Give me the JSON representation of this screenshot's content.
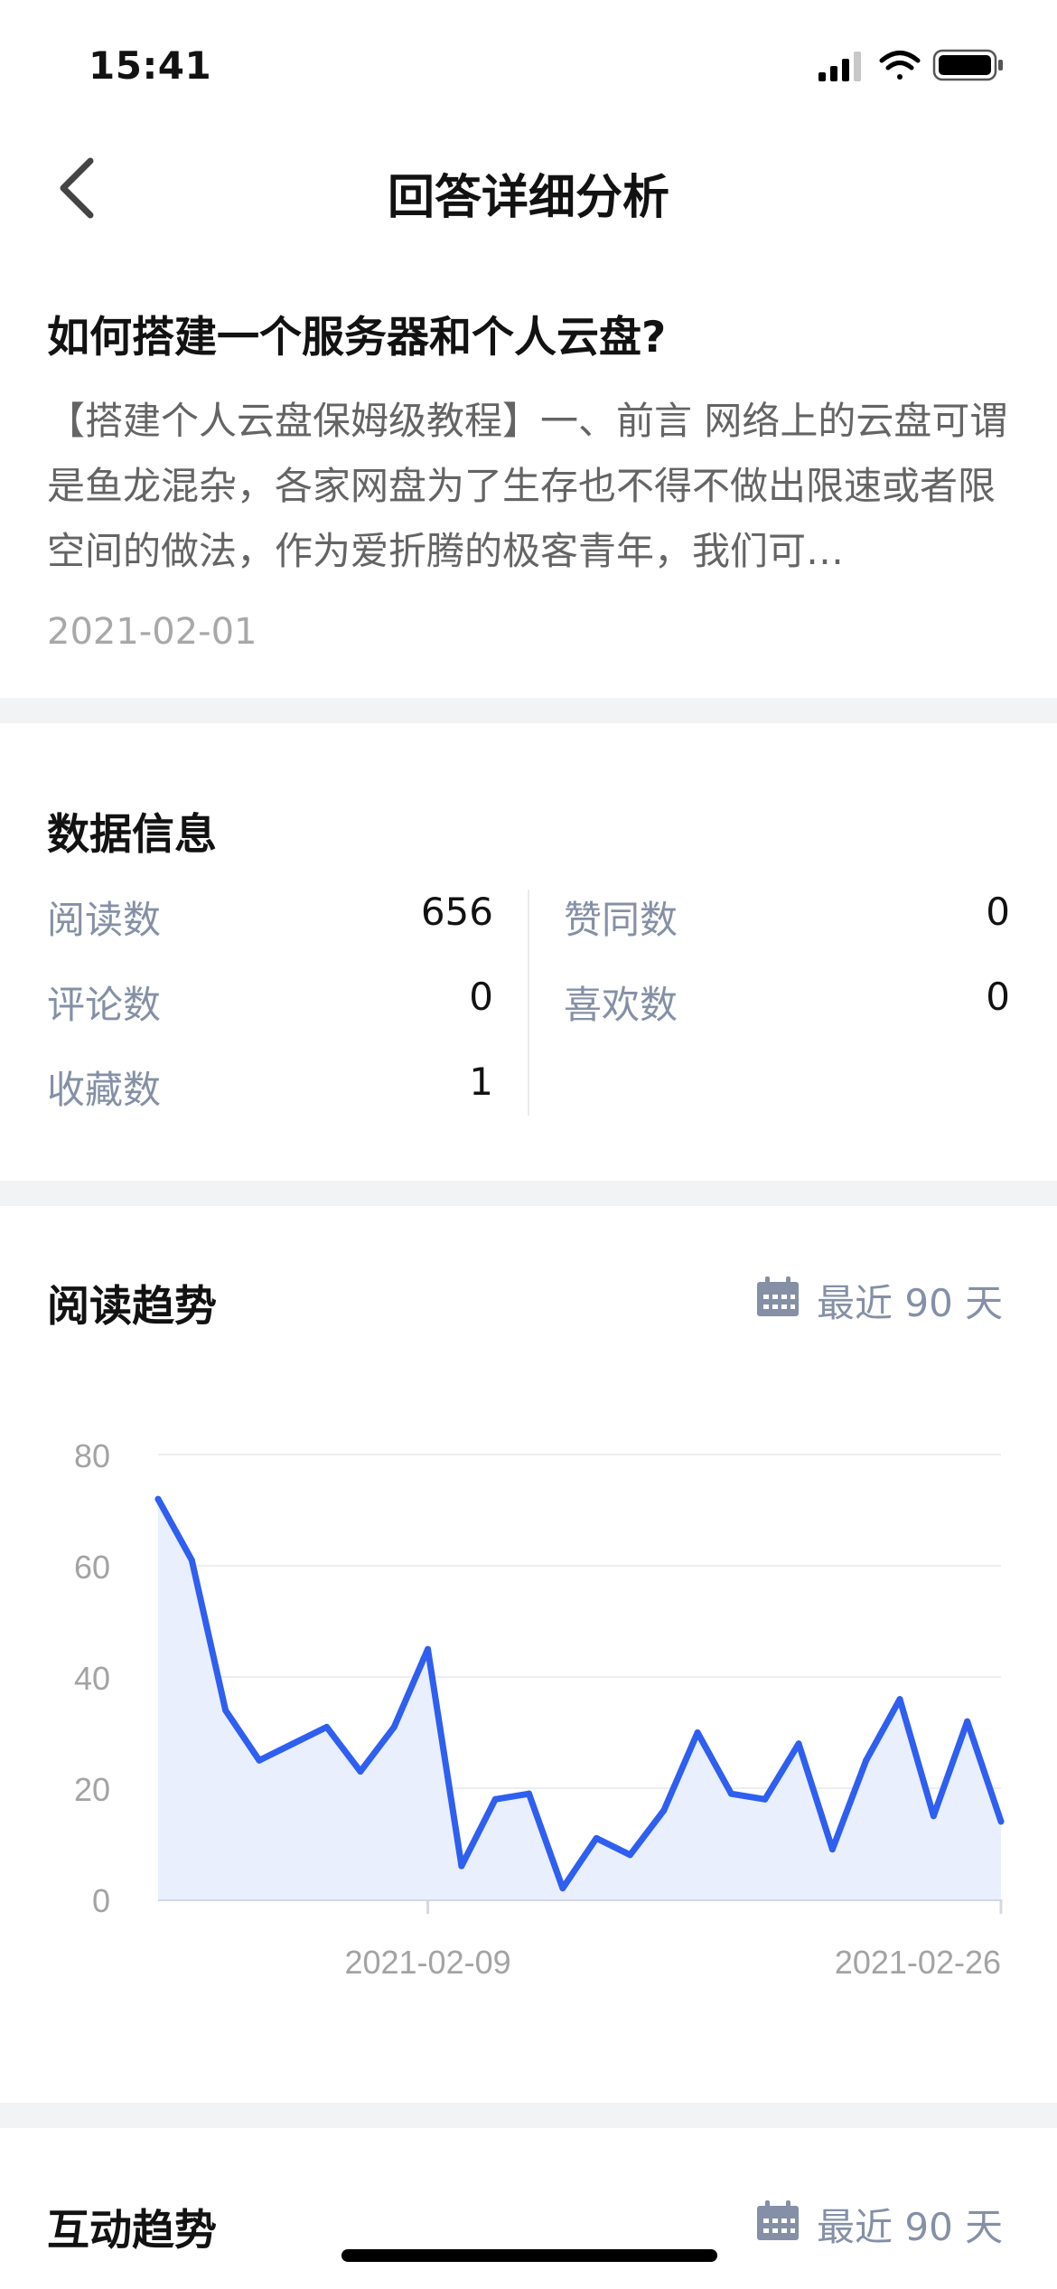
{
  "status_bar": {
    "time": "15:41"
  },
  "nav": {
    "title": "回答详细分析",
    "back_icon": "chevron-left-icon"
  },
  "answer": {
    "question": "如何搭建一个服务器和个人云盘?",
    "excerpt": "【搭建个人云盘保姆级教程】一、前言 网络上的云盘可谓是鱼龙混杂，各家网盘为了生存也不得不做出限速或者限空间的做法，作为爱折腾的极客青年，我们可…",
    "date": "2021-02-01"
  },
  "stats": {
    "title": "数据信息",
    "left": [
      {
        "label": "阅读数",
        "value": "656"
      },
      {
        "label": "评论数",
        "value": "0"
      },
      {
        "label": "收藏数",
        "value": "1"
      }
    ],
    "right": [
      {
        "label": "赞同数",
        "value": "0"
      },
      {
        "label": "喜欢数",
        "value": "0"
      }
    ]
  },
  "read_trend": {
    "title": "阅读趋势",
    "range_label": "最近 90 天",
    "range_icon": "calendar-icon"
  },
  "interaction_trend": {
    "title": "互动趋势",
    "range_label": "最近 90 天",
    "range_icon": "calendar-icon"
  },
  "colors": {
    "line": "#2e5ff0",
    "area": "#e9effd",
    "label": "#8590a6",
    "tick": "#a3a3a3"
  },
  "chart_data": {
    "type": "area",
    "xlabel": "",
    "ylabel": "",
    "ylim": [
      0,
      80
    ],
    "yticks": [
      0,
      20,
      40,
      60,
      80
    ],
    "x_tick_labels": [
      "2021-02-09",
      "2021-02-26"
    ],
    "x_tick_indices": [
      8,
      25
    ],
    "grid": true,
    "series": [
      {
        "values": [
          72,
          61,
          34,
          25,
          28,
          31,
          23,
          31,
          45,
          6,
          18,
          19,
          2,
          11,
          8,
          16,
          30,
          19,
          18,
          28,
          9,
          25,
          36,
          15,
          32,
          14
        ]
      }
    ]
  }
}
